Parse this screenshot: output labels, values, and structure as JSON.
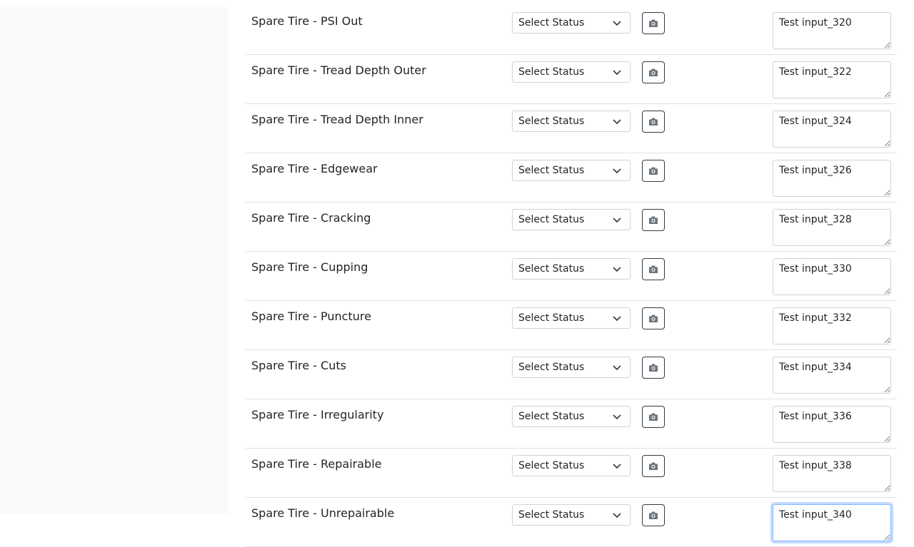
{
  "rows": [
    {
      "label": "Spare Tire - PSI Out",
      "status": "Select Status",
      "notes": "Test input_320"
    },
    {
      "label": "Spare Tire - Tread Depth Outer",
      "status": "Select Status",
      "notes": "Test input_322"
    },
    {
      "label": "Spare Tire - Tread Depth Inner",
      "status": "Select Status",
      "notes": "Test input_324"
    },
    {
      "label": "Spare Tire - Edgewear",
      "status": "Select Status",
      "notes": "Test input_326"
    },
    {
      "label": "Spare Tire - Cracking",
      "status": "Select Status",
      "notes": "Test input_328"
    },
    {
      "label": "Spare Tire - Cupping",
      "status": "Select Status",
      "notes": "Test input_330"
    },
    {
      "label": "Spare Tire - Puncture",
      "status": "Select Status",
      "notes": "Test input_332"
    },
    {
      "label": "Spare Tire - Cuts",
      "status": "Select Status",
      "notes": "Test input_334"
    },
    {
      "label": "Spare Tire - Irregularity",
      "status": "Select Status",
      "notes": "Test input_336"
    },
    {
      "label": "Spare Tire - Repairable",
      "status": "Select Status",
      "notes": "Test input_338"
    },
    {
      "label": "Spare Tire - Unrepairable",
      "status": "Select Status",
      "notes": "Test input_340"
    }
  ],
  "icons": {
    "camera": "camera-icon",
    "chevron": "chevron-down-icon"
  },
  "colors": {
    "sidebar_bg": "#f8f9fa",
    "focus_border": "#86b7fe",
    "row_border": "#dee2e6"
  }
}
